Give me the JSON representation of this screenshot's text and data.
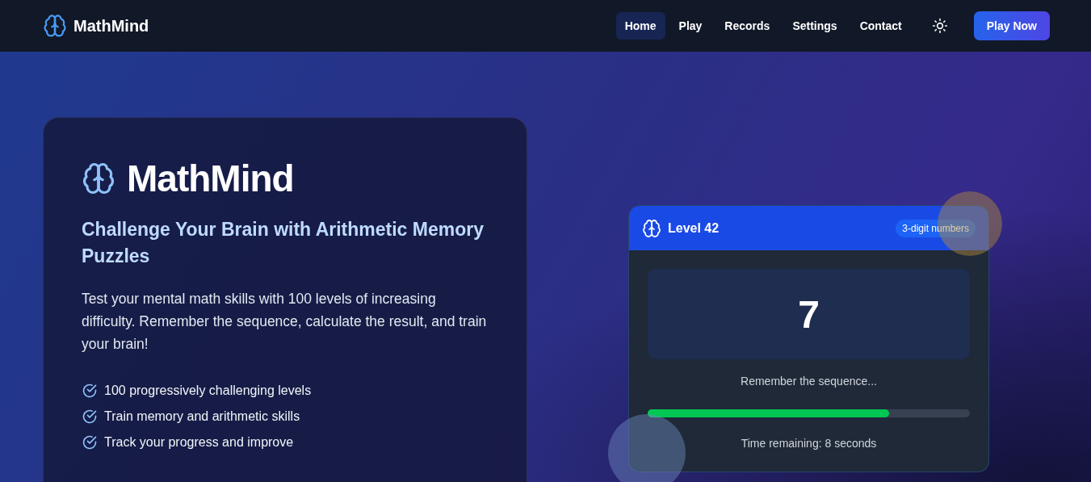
{
  "nav": {
    "brand": "MathMind",
    "links": [
      {
        "label": "Home",
        "selected": true
      },
      {
        "label": "Play",
        "selected": false
      },
      {
        "label": "Records",
        "selected": false
      },
      {
        "label": "Settings",
        "selected": false
      },
      {
        "label": "Contact",
        "selected": false
      }
    ],
    "cta": "Play Now"
  },
  "hero": {
    "title": "MathMind",
    "subtitle": "Challenge Your Brain with Arithmetic Memory Puzzles",
    "description": "Test your mental math skills with 100 levels of increasing difficulty. Remember the sequence, calculate the result, and train your brain!",
    "features": [
      "100 progressively challenging levels",
      "Train memory and arithmetic skills",
      "Track your progress and improve"
    ]
  },
  "game_card": {
    "level": "Level 42",
    "badge": "3-digit numbers",
    "number": "7",
    "prompt": "Remember the sequence...",
    "level_progress": {
      "level": 0.75
    },
    "timer": "Time remaining: 8 seconds"
  }
}
